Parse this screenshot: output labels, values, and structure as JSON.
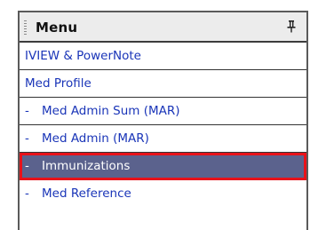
{
  "menu": {
    "title": "Menu",
    "pin_icon": "pin-icon",
    "items": [
      {
        "label": "IVIEW & PowerNote",
        "indented": false
      },
      {
        "label": "Med Profile",
        "indented": false
      },
      {
        "dash": "-",
        "label": "Med Admin Sum (MAR)",
        "indented": true
      },
      {
        "dash": "-",
        "label": "Med Admin (MAR)",
        "indented": true
      },
      {
        "dash": "-",
        "label": "Immunizations",
        "indented": true,
        "selected": true
      },
      {
        "dash": "-",
        "label": "Med Reference",
        "indented": true
      }
    ]
  },
  "colors": {
    "link": "#1a35b8",
    "selected_bg": "#5b628d",
    "highlight_border": "#e8121a"
  }
}
